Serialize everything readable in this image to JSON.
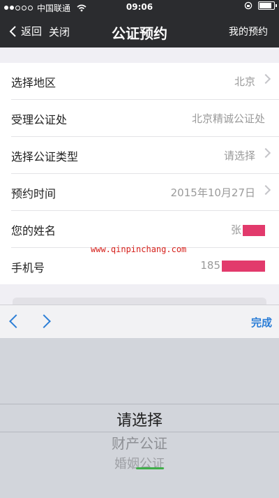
{
  "status_bar": {
    "carrier": "中国联通",
    "time": "09:06",
    "signal_icon": "signal-dots-icon",
    "wifi_icon": "wifi-icon",
    "lock_icon": "rotation-lock-icon",
    "battery_icon": "battery-icon"
  },
  "nav": {
    "back_label": "返回",
    "close_label": "关闭",
    "title": "公证预约",
    "right_label": "我的预约"
  },
  "form": {
    "rows": [
      {
        "label": "选择地区",
        "value": "北京",
        "has_arrow": true
      },
      {
        "label": "受理公证处",
        "value": "北京精诚公证处",
        "has_arrow": false
      },
      {
        "label": "选择公证类型",
        "value": "请选择",
        "has_arrow": true
      },
      {
        "label": "预约时间",
        "value": "2015年10月27日",
        "has_arrow": true
      },
      {
        "label": "您的姓名",
        "value": "张",
        "has_arrow": false
      },
      {
        "label": "手机号",
        "value": "185",
        "has_arrow": false
      }
    ]
  },
  "watermark": "www.qinpinchang.com",
  "toolbar": {
    "done_label": "完成"
  },
  "picker": {
    "options": [
      "请选择",
      "财产公证",
      "婚姻公证"
    ],
    "selected": "请选择"
  },
  "colors": {
    "nav_bg": "#2b2c2f",
    "accent": "#2b7dd6",
    "redaction": "#e23a6c",
    "watermark": "#d6201b"
  }
}
